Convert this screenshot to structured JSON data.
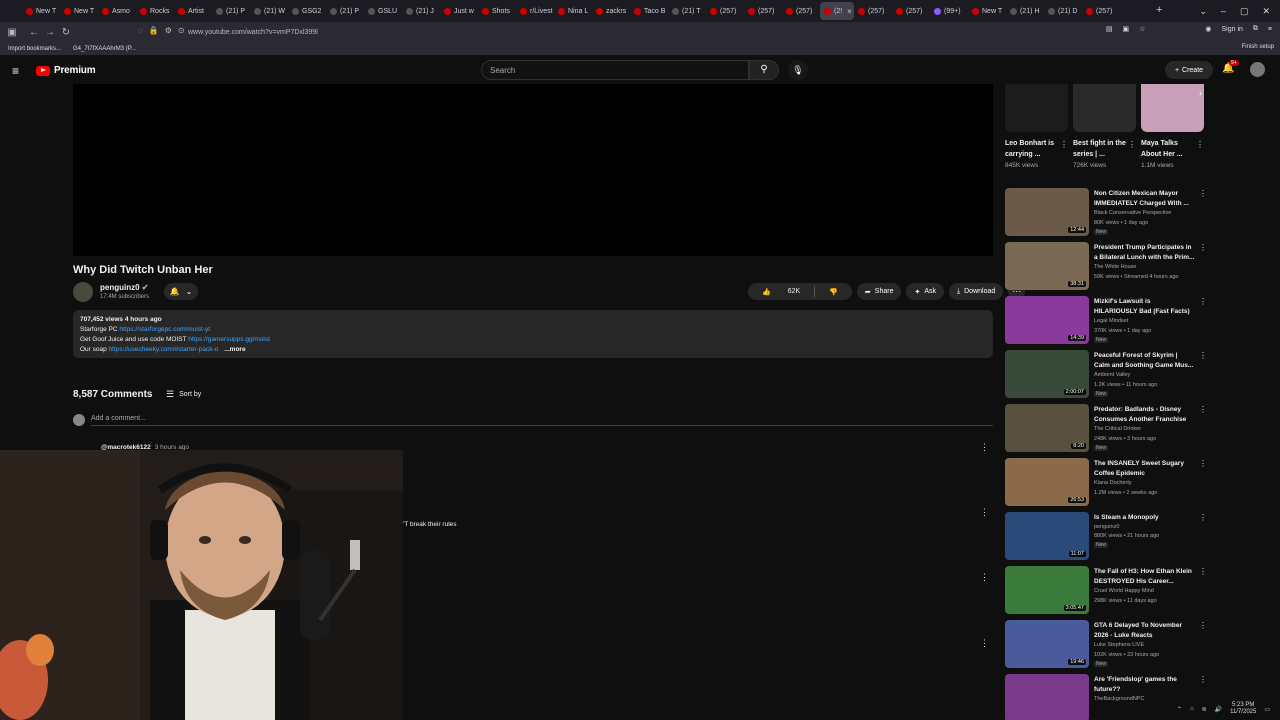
{
  "browser": {
    "tabs": [
      "New T",
      "New T",
      "Asmo",
      "Rocks",
      "Artist",
      "(21) P",
      "(21) W",
      "GSG2",
      "(21) P",
      "GSLU",
      "(21) J",
      "Just w",
      "Shots",
      "r/Livest",
      "Nina L",
      "zackrs",
      "Taco B",
      "(21) T",
      "(257)",
      "(257)",
      "(257)",
      "(2!",
      "(257)",
      "(257)",
      "(99+)",
      "New T",
      "(21) H",
      "(21) D",
      "(257)"
    ],
    "url": "www.youtube.com/watch?v=vmP7Dxl399l",
    "sign_in": "Sign in",
    "bookmarks": [
      "Import bookmarks...",
      "G4_7t7fXAAAhrM3 (P..."
    ],
    "finish_setup": "Finish setup"
  },
  "masthead": {
    "logo_text": "Premium",
    "search_placeholder": "Search",
    "create_label": "Create",
    "notif_badge": "9+"
  },
  "video": {
    "title": "Why Did Twitch Unban Her",
    "channel": "penguinz0",
    "subscribers": "17.4M subscribers",
    "likes": "62K",
    "share": "Share",
    "ask": "Ask",
    "download": "Download",
    "description": {
      "meta": "707,452 views  4 hours ago",
      "line1_prefix": "Starforge PC ",
      "line1_link": "https://starforgepc.com/moist-yt",
      "line2_prefix": "Get Goof Juice and use code MOIST ",
      "line2_link": "https://gamersupps.gg/moist",
      "line3_prefix": "Our soap ",
      "line3_link": "https://usecheeky.com/#starter-pack-o",
      "more": "...more"
    }
  },
  "comments": {
    "count": "8,587 Comments",
    "sort_label": "Sort by",
    "add_placeholder": "Add a comment...",
    "first_user": "@macrotek6122",
    "first_time": "3 hours ago",
    "first_fragment": "'T break their rules"
  },
  "shorts": [
    {
      "title": "Leo Bonhart is carrying ...",
      "views": "845K views"
    },
    {
      "title": "Best fight in the series | ...",
      "views": "726K views"
    },
    {
      "title": "Maya Talks About Her ...",
      "views": "1.1M views"
    }
  ],
  "recommendations": [
    {
      "title1": "Non Citizen Mexican Mayor",
      "title2": "IMMEDIATELY Charged With ...",
      "channel": "Black Conservative Perspective",
      "meta": "80K views • 1 day ago",
      "new": "New",
      "duration": "12:44",
      "color": "#6b5a4a"
    },
    {
      "title1": "President Trump Participates in",
      "title2": "a Bilateral Lunch with the Prim...",
      "channel": "The White House",
      "meta": "59K views • Streamed 4 hours ago",
      "new": "",
      "duration": "38:31",
      "color": "#7a6a55"
    },
    {
      "title1": "Mizkif's Lawsuit is",
      "title2": "HILARIOUSLY Bad (Fast Facts)",
      "channel": "Legal Mindset",
      "meta": "370K views • 1 day ago",
      "new": "New",
      "duration": "14:39",
      "color": "#8a3a9a"
    },
    {
      "title1": "Peaceful Forest of Skyrim |",
      "title2": "Calm and Soothing Game Mus...",
      "channel": "Ambient Valley",
      "meta": "1.2K views • 11 hours ago",
      "new": "New",
      "duration": "2:00:07",
      "color": "#3a4a3a"
    },
    {
      "title1": "Predator: Badlands - Disney",
      "title2": "Consumes Another Franchise",
      "channel": "The Critical Drinker",
      "meta": "248K views • 3 hours ago",
      "new": "New",
      "duration": "8:20",
      "color": "#5a5040"
    },
    {
      "title1": "The INSANELY Sweet Sugary",
      "title2": "Coffee Epidemic",
      "channel": "Kiana Docherty",
      "meta": "1.2M views • 2 weeks ago",
      "new": "",
      "duration": "26:53",
      "color": "#8a6a4a"
    },
    {
      "title1": "Is Steam a Monopoly",
      "title2": "",
      "channel": "penguinz0",
      "meta": "880K views • 21 hours ago",
      "new": "New",
      "duration": "11:07",
      "color": "#2a4a7a"
    },
    {
      "title1": "The Fall of H3: How Ethan Klein",
      "title2": "DESTROYED His Career...",
      "channel": "Cruel World Happy Mind",
      "meta": "298K views • 11 days ago",
      "new": "",
      "duration": "3:05:47",
      "color": "#3a7a3a"
    },
    {
      "title1": "GTA 6 Delayed To November",
      "title2": "2026 - Luke Reacts",
      "channel": "Luke Stephens LIVE",
      "meta": "102K views • 23 hours ago",
      "new": "New",
      "duration": "19:46",
      "color": "#4a5a9a"
    },
    {
      "title1": "Are 'Friendslop' games the",
      "title2": "future??",
      "channel": "TheBackgroundNPC",
      "meta": "",
      "new": "",
      "duration": "",
      "color": "#7a3a8a"
    }
  ],
  "tray": {
    "time": "5:23 PM",
    "date": "11/7/2025"
  }
}
